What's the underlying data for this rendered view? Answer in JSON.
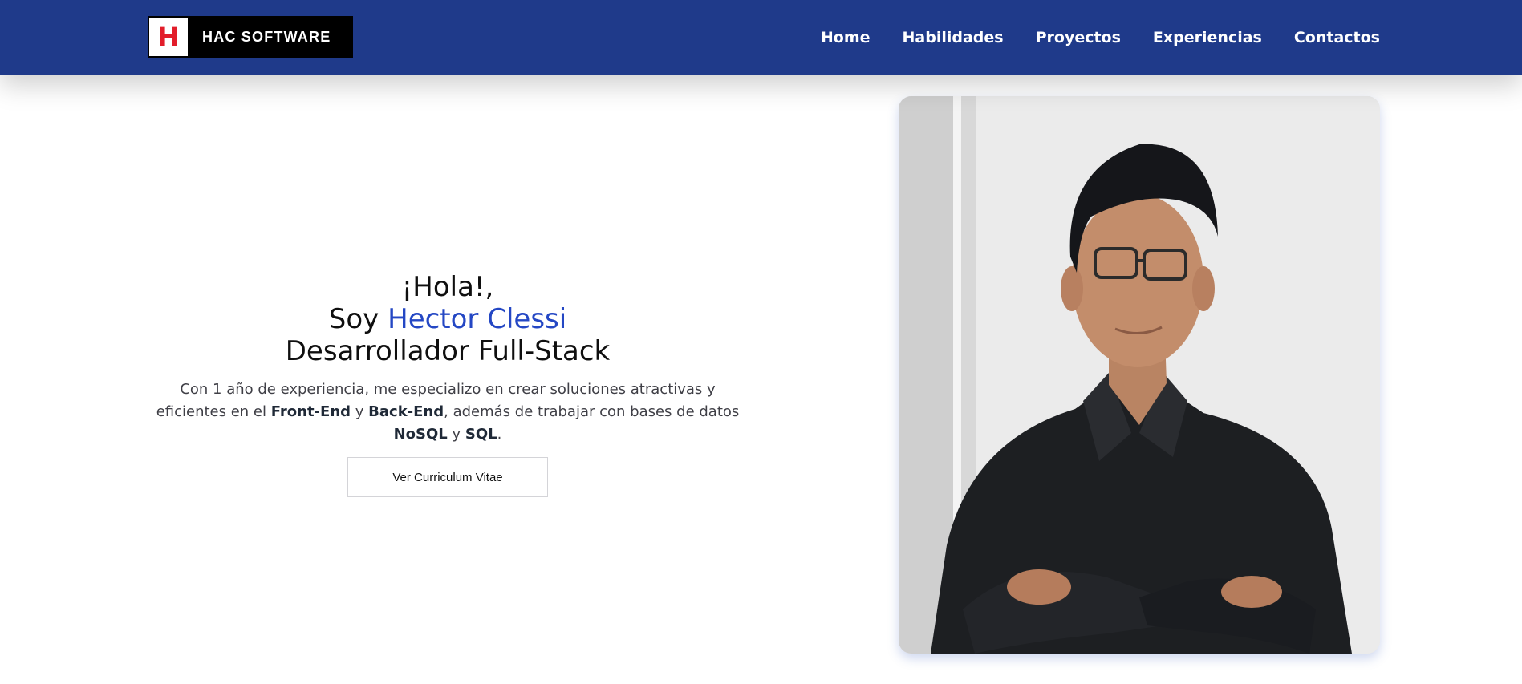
{
  "nav": {
    "logo": {
      "mark": "H",
      "text": "HAC SOFTWARE"
    },
    "links": [
      "Home",
      "Habilidades",
      "Proyectos",
      "Experiencias",
      "Contactos"
    ]
  },
  "hero": {
    "greeting": "¡Hola!,",
    "intro": "Soy",
    "name": "Hector Clessi",
    "role": "Desarrollador Full-Stack",
    "description": {
      "part1": "Con 1 año de experiencia, me especializo en crear soluciones atractivas y eficientes en el",
      "frontend": "Front-End",
      "and1": "y",
      "backend": "Back-End",
      "part2": ", además de trabajar con bases de datos",
      "nosql": "NoSQL",
      "and2": "y",
      "sql": "SQL",
      "end": "."
    },
    "cv_button": "Ver Curriculum Vitae"
  },
  "colors": {
    "navbar": "#1f3a8a",
    "accent": "#2447c4",
    "logo_red": "#e21d2a"
  }
}
